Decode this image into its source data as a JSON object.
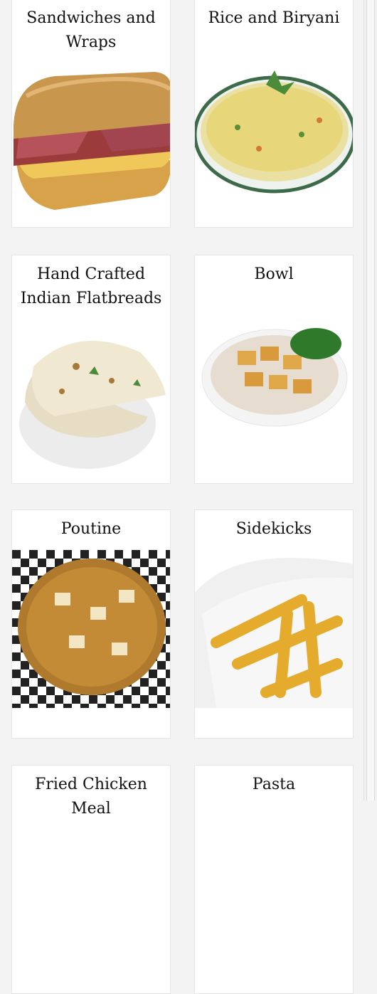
{
  "categories": [
    {
      "title": "Sandwiches and Wraps",
      "image": "sandwich-photo"
    },
    {
      "title": "Rice and Biryani",
      "image": "rice-biryani-photo"
    },
    {
      "title": "Hand Crafted Indian Flatbreads",
      "image": "naan-flatbread-photo"
    },
    {
      "title": "Bowl",
      "image": "paneer-bowl-photo"
    },
    {
      "title": "Poutine",
      "image": "poutine-photo"
    },
    {
      "title": "Sidekicks",
      "image": "fries-photo"
    },
    {
      "title": "Fried Chicken Meal",
      "image": ""
    },
    {
      "title": "Pasta",
      "image": ""
    }
  ]
}
